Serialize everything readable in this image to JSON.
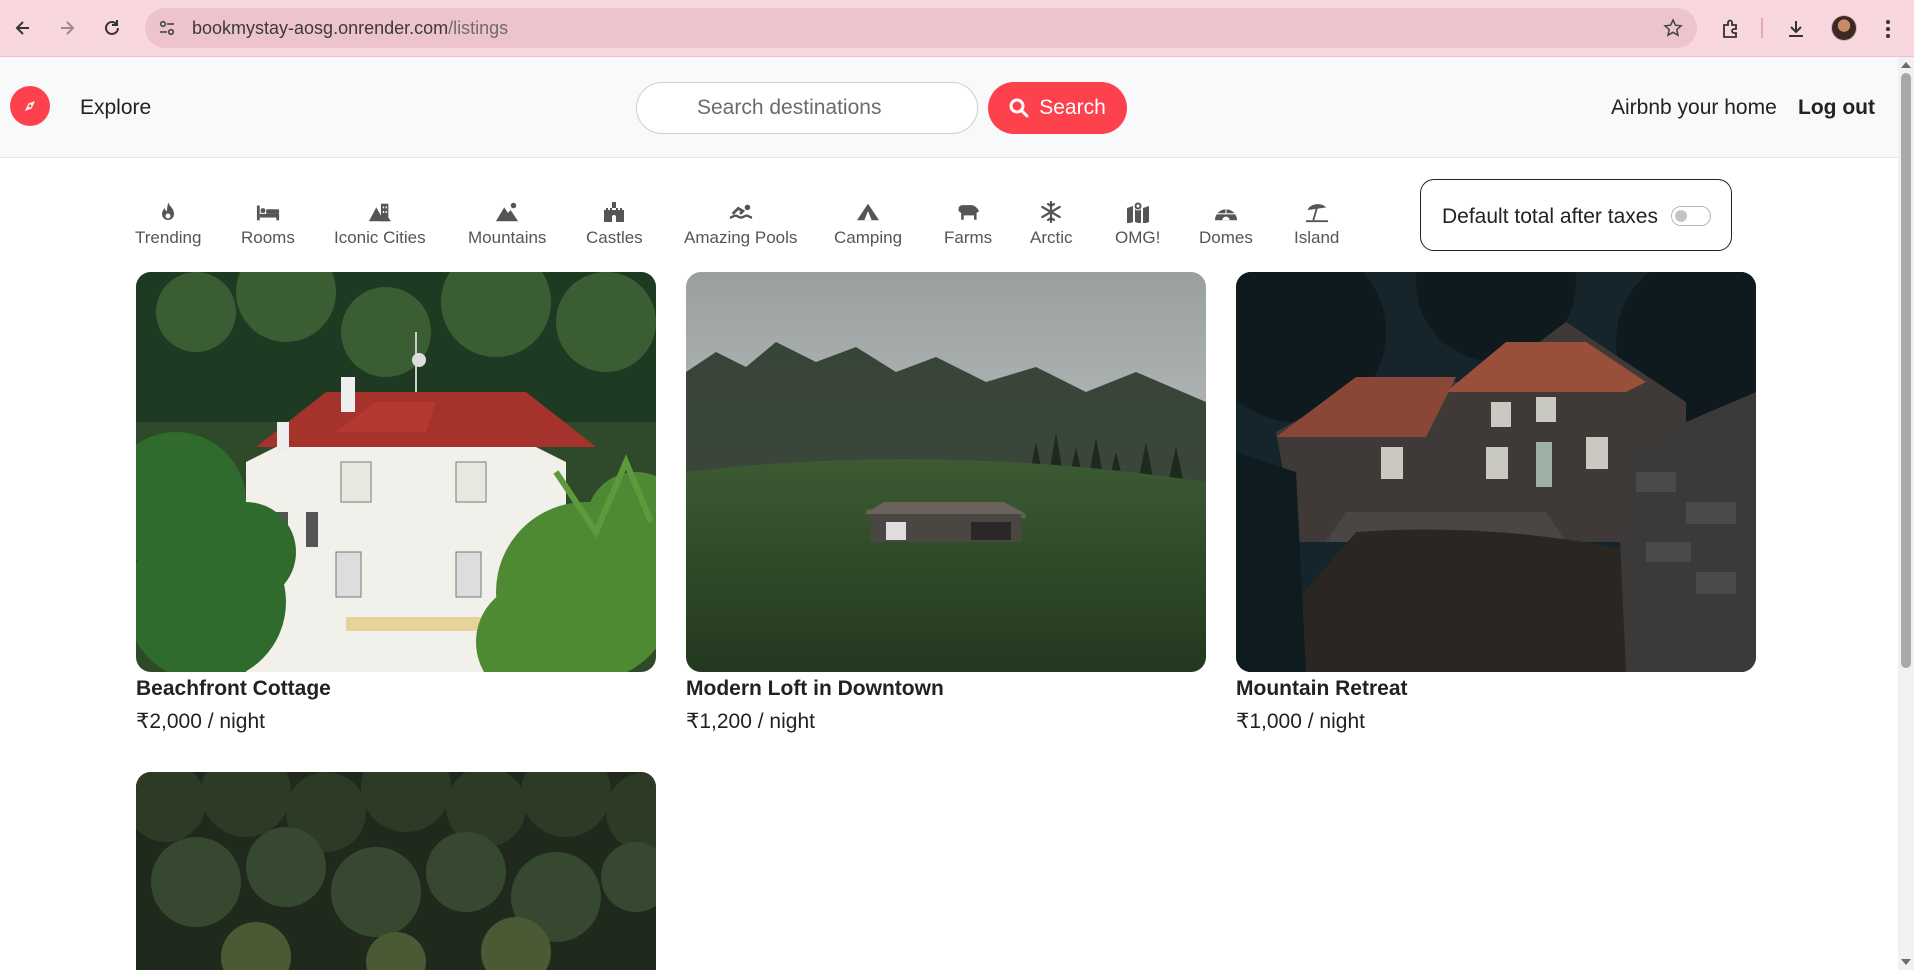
{
  "browser": {
    "url_domain": "bookmystay-aosg.onrender.com",
    "url_path": "/listings",
    "icons": [
      "back-icon",
      "forward-icon",
      "reload-icon",
      "site-info-icon",
      "bookmark-star-icon",
      "extensions-icon",
      "downloads-icon",
      "profile-avatar",
      "menu-dots-icon"
    ]
  },
  "header": {
    "explore_label": "Explore",
    "search_placeholder": "Search destinations",
    "search_button_label": "Search",
    "host_link": "Airbnb your home",
    "logout_link": "Log out",
    "brand_color": "#fe424d"
  },
  "filters": [
    {
      "label": "Trending",
      "icon": "fire-icon"
    },
    {
      "label": "Rooms",
      "icon": "bed-icon"
    },
    {
      "label": "Iconic Cities",
      "icon": "mountain-city-icon"
    },
    {
      "label": "Mountains",
      "icon": "mountain-sun-icon"
    },
    {
      "label": "Castles",
      "icon": "castle-icon"
    },
    {
      "label": "Amazing Pools",
      "icon": "person-swimming-icon"
    },
    {
      "label": "Camping",
      "icon": "campground-icon"
    },
    {
      "label": "Farms",
      "icon": "cow-icon"
    },
    {
      "label": "Arctic",
      "icon": "snowflake-icon"
    },
    {
      "label": "OMG!",
      "icon": "map-location-icon"
    },
    {
      "label": "Domes",
      "icon": "igloo-icon"
    },
    {
      "label": "Island",
      "icon": "umbrella-beach-icon"
    }
  ],
  "tax_toggle": {
    "label": "Default total after taxes",
    "checked": false
  },
  "listings": [
    {
      "title": "Beachfront Cottage",
      "price": "₹2,000 / night"
    },
    {
      "title": "Modern Loft in Downtown",
      "price": "₹1,200 / night"
    },
    {
      "title": "Mountain Retreat",
      "price": "₹1,000 / night"
    },
    {
      "title": "",
      "price": ""
    }
  ]
}
